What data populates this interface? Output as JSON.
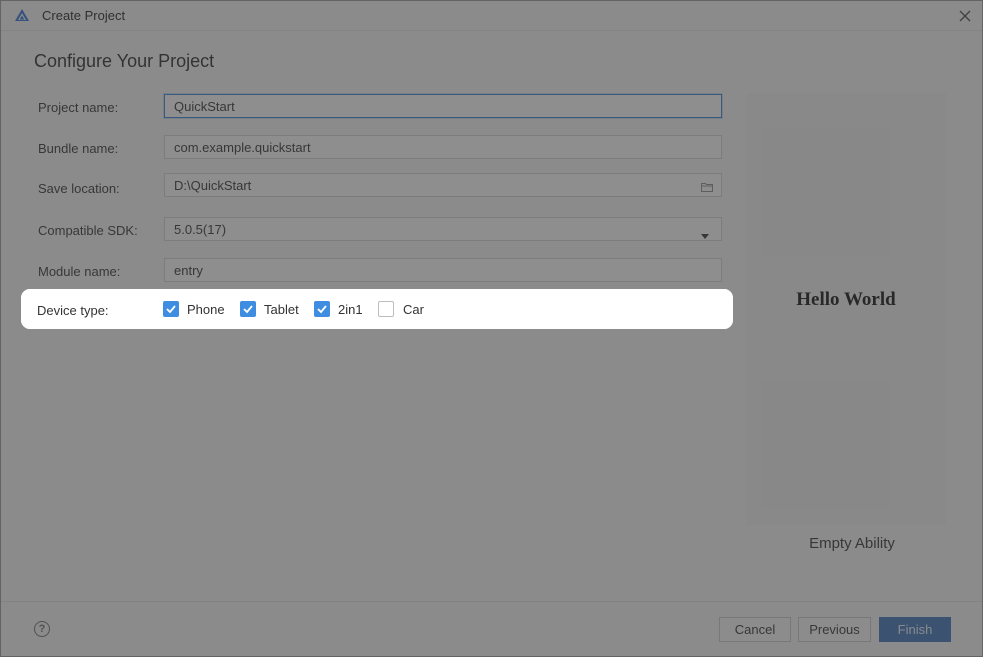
{
  "window": {
    "title": "Create Project",
    "close_icon": "close-icon",
    "app_icon": "deveco-logo-icon"
  },
  "page": {
    "heading": "Configure Your Project"
  },
  "form": {
    "project_name": {
      "label": "Project name:",
      "value": "QuickStart"
    },
    "bundle_name": {
      "label": "Bundle name:",
      "value": "com.example.quickstart"
    },
    "save_location": {
      "label": "Save location:",
      "value": "D:\\QuickStart",
      "icon": "folder-icon"
    },
    "compatible_sdk": {
      "label": "Compatible SDK:",
      "value": "5.0.5(17)",
      "icon": "chevron-down-icon"
    },
    "module_name": {
      "label": "Module name:",
      "value": "entry"
    },
    "device_type": {
      "label": "Device type:",
      "options": [
        {
          "label": "Phone",
          "checked": true
        },
        {
          "label": "Tablet",
          "checked": true
        },
        {
          "label": "2in1",
          "checked": true
        },
        {
          "label": "Car",
          "checked": false
        }
      ]
    }
  },
  "preview": {
    "text": "Hello World",
    "template_name": "Empty Ability"
  },
  "footer": {
    "help_icon": "help-icon",
    "help_glyph": "?",
    "cancel_label": "Cancel",
    "previous_label": "Previous",
    "finish_label": "Finish"
  },
  "colors": {
    "accent": "#3f8de0",
    "primary_button": "#3c72b5",
    "overlay": "#3a3a3a"
  }
}
